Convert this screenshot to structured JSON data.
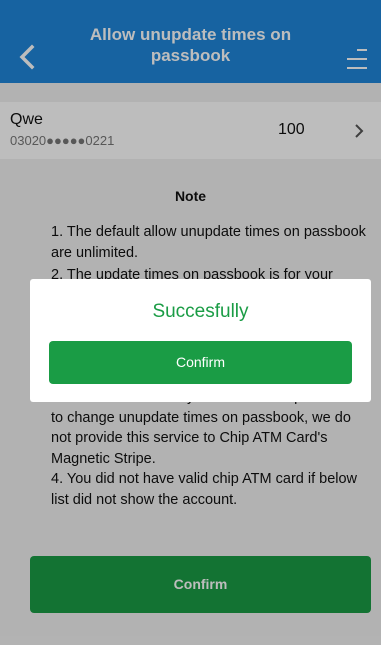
{
  "header": {
    "title": "Allow unupdate times on passbook",
    "back_icon": "chevron-left-icon",
    "menu_icon": "menu-icon",
    "background": "#1f86d9"
  },
  "account": {
    "name": "Qwe",
    "number": "03020●●●●●0221",
    "amount": "100",
    "chevron_icon": "chevron-right-icon"
  },
  "note": {
    "title": "Note",
    "item1": "1. The default allow unupdate times on passbook are unlimited.",
    "item2": "2. The update times on passbook is for your",
    "item3": "3. This function is only available to chip ATM card to change unupdate times on passbook, we do not provide this service to Chip ATM Card's Magnetic Stripe.",
    "item4": "4. You did not have valid chip ATM card if below list did not show the account."
  },
  "confirm_label": "Confirm",
  "dialog": {
    "message": "Succesfully",
    "button_label": "Confirm"
  },
  "colors": {
    "accent": "#1f86d9",
    "success": "#1a9c45",
    "background": "#f1f1f1"
  }
}
